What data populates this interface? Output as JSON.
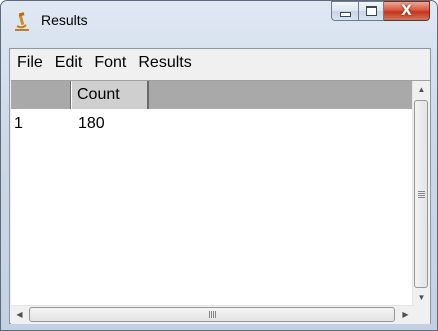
{
  "window": {
    "title": "Results",
    "icon": "microscope-icon"
  },
  "controls": {
    "minimize": "minimize-icon",
    "maximize": "maximize-icon",
    "close_glyph": "X"
  },
  "menubar": {
    "items": [
      {
        "label": "File"
      },
      {
        "label": "Edit"
      },
      {
        "label": "Font"
      },
      {
        "label": "Results"
      }
    ]
  },
  "table": {
    "columns": [
      "",
      "Count"
    ],
    "rows": [
      {
        "index": "1",
        "count": "180"
      }
    ]
  },
  "scrollbars": {
    "horizontal_grip": "III"
  }
}
